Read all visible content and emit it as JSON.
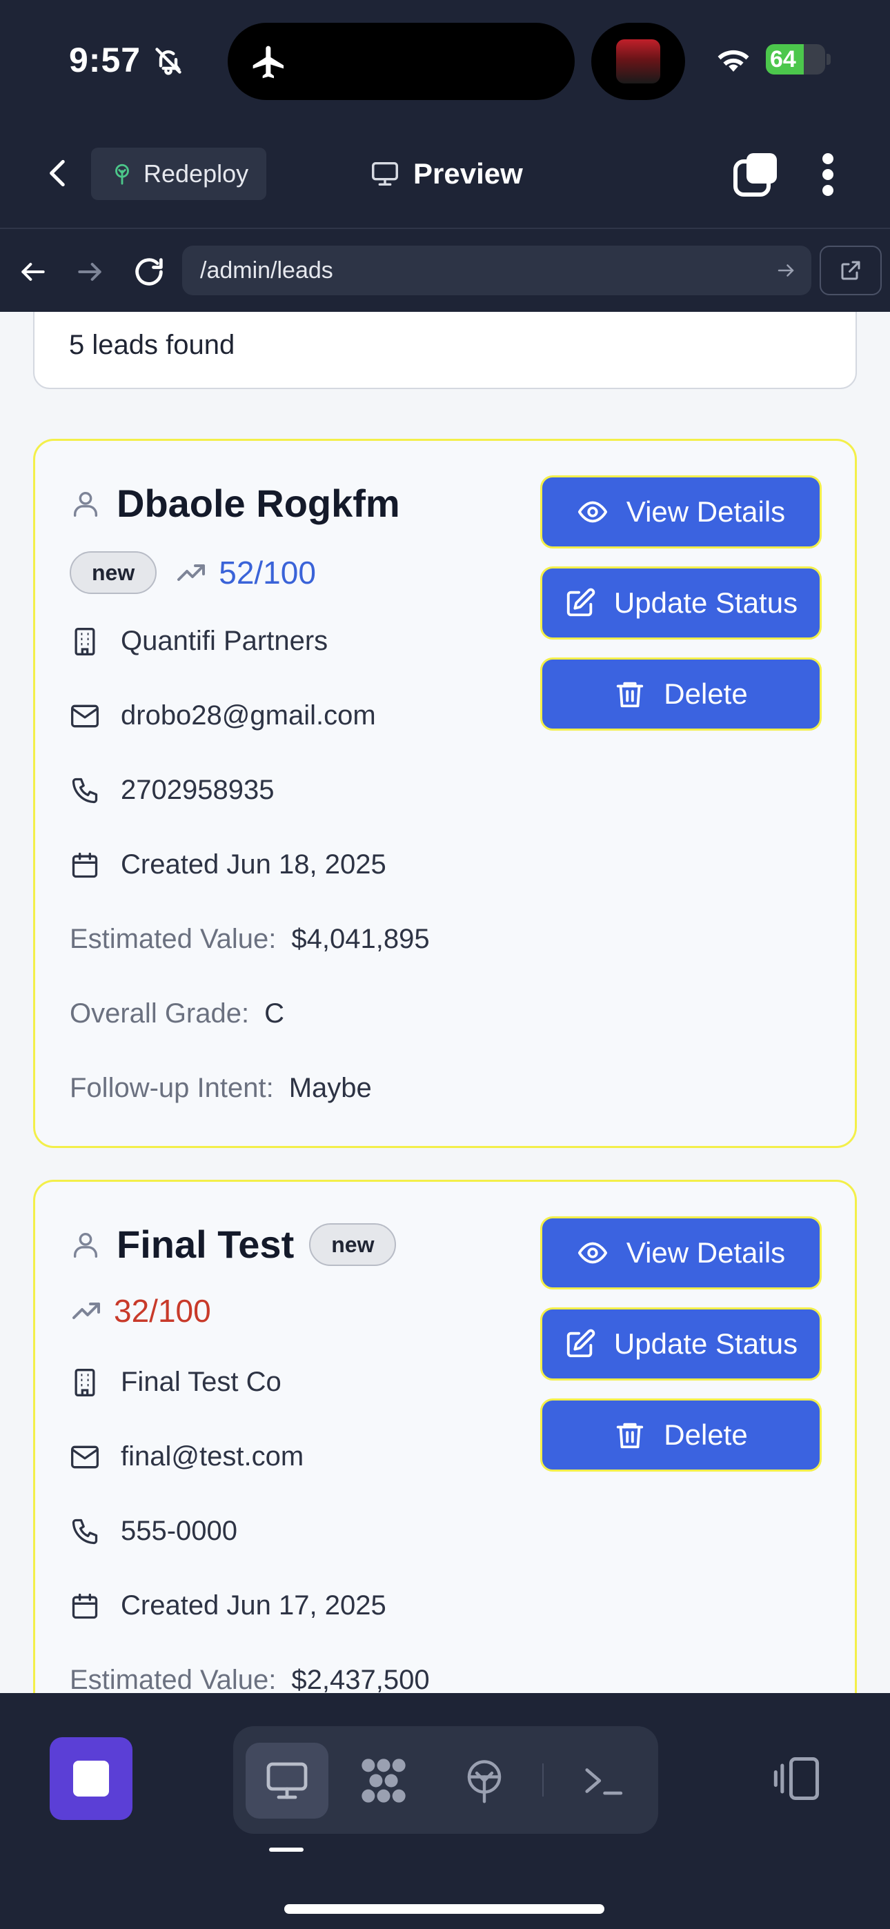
{
  "status_bar": {
    "time": "9:57",
    "battery": "64",
    "battery_level": 0.64
  },
  "header": {
    "redeploy_label": "Redeploy",
    "preview_label": "Preview"
  },
  "url_bar": {
    "url": "/admin/leads"
  },
  "summary": {
    "text": "5 leads found"
  },
  "leads": [
    {
      "name": "Dbaole Rogkfm",
      "status": "new",
      "score": "52/100",
      "score_color": "#3a63d8",
      "company": "Quantifi Partners",
      "email": "drobo28@gmail.com",
      "phone": "2702958935",
      "created": "Created Jun 18, 2025",
      "estimated_value_label": "Estimated Value:",
      "estimated_value": "$4,041,895",
      "grade_label": "Overall Grade:",
      "grade": "C",
      "followup_label": "Follow-up Intent:",
      "followup": "Maybe",
      "actions": {
        "view": "View Details",
        "update": "Update Status",
        "delete": "Delete"
      }
    },
    {
      "name": "Final Test",
      "status": "new",
      "score": "32/100",
      "score_color": "#c83a2a",
      "company": "Final Test Co",
      "email": "final@test.com",
      "phone": "555-0000",
      "created": "Created Jun 17, 2025",
      "estimated_value_label": "Estimated Value:",
      "estimated_value": "$2,437,500",
      "actions": {
        "view": "View Details",
        "update": "Update Status",
        "delete": "Delete"
      }
    }
  ],
  "colors": {
    "accent": "#3b63e0",
    "highlight_border": "#f3ef4a",
    "background_dark": "#1e2436",
    "stop_button": "#5b3fd6"
  }
}
